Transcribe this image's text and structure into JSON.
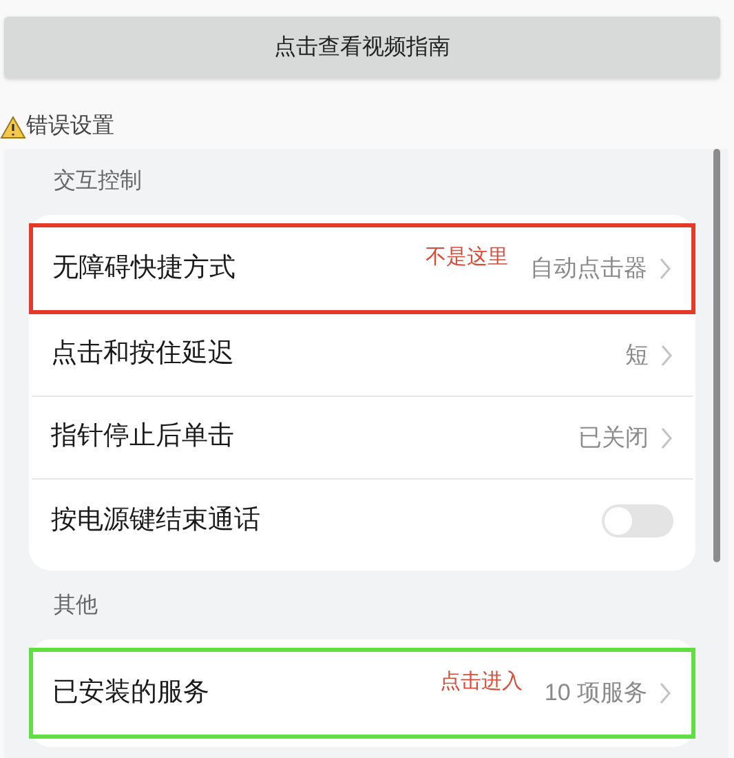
{
  "guide_button": {
    "label": "点击查看视频指南"
  },
  "warning": {
    "label": "错误设置"
  },
  "sections": [
    {
      "title": "交互控制",
      "items": [
        {
          "kind": "link",
          "label": "无障碍快捷方式",
          "value": "自动点击器",
          "annotation": {
            "note": "不是这里",
            "color": "#e53a2a"
          }
        },
        {
          "kind": "link",
          "label": "点击和按住延迟",
          "value": "短"
        },
        {
          "kind": "link",
          "label": "指针停止后单击",
          "value": "已关闭"
        },
        {
          "kind": "toggle",
          "label": "按电源键结束通话",
          "on": false
        }
      ]
    },
    {
      "title": "其他",
      "items": [
        {
          "kind": "link",
          "label": "已安装的服务",
          "value": "10 项服务",
          "annotation": {
            "note": "点击进入",
            "color": "#5fe040"
          }
        }
      ]
    }
  ]
}
